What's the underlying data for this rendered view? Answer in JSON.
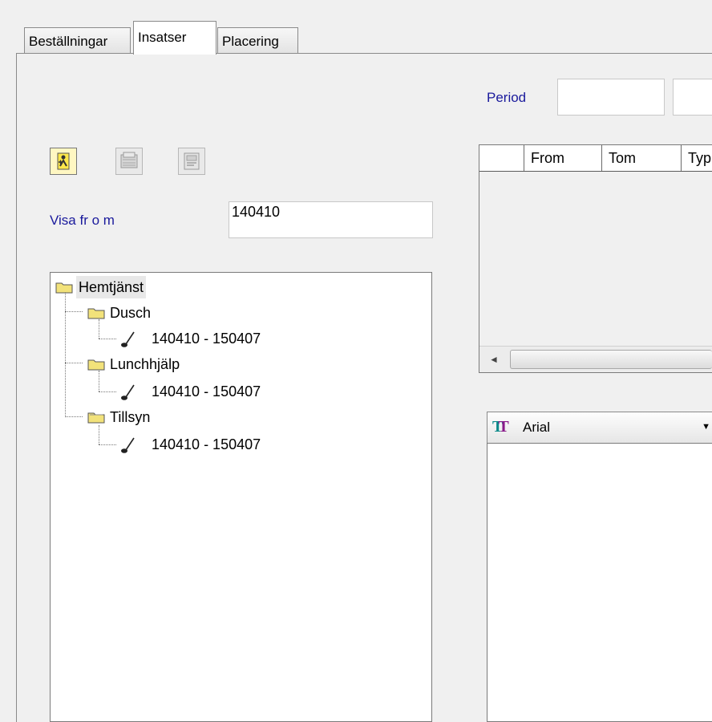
{
  "tabs": [
    {
      "label": "Beställningar",
      "active": false
    },
    {
      "label": "Insatser",
      "active": true
    },
    {
      "label": "Placering",
      "active": false
    }
  ],
  "toolbar": {
    "buttons": [
      {
        "icon": "add-person-icon",
        "enabled": true
      },
      {
        "icon": "printer-icon",
        "enabled": false
      },
      {
        "icon": "edit-form-icon",
        "enabled": false
      }
    ]
  },
  "filter": {
    "label": "Visa fr o m",
    "value": "140410"
  },
  "period": {
    "label": "Period",
    "from_value": "",
    "to_value": ""
  },
  "tree": {
    "root": "Hemtjänst",
    "children": [
      {
        "label": "Dusch",
        "item": "140410 - 150407"
      },
      {
        "label": "Lunchhjälp",
        "item": "140410 - 150407"
      },
      {
        "label": "Tillsyn",
        "item": "140410 - 150407"
      }
    ]
  },
  "grid": {
    "columns": [
      "From",
      "Tom",
      "Typ"
    ],
    "rows": []
  },
  "editor": {
    "font_name": "Arial",
    "font_icon": "truetype-font-icon",
    "text": ""
  },
  "colors": {
    "label_blue": "#1a1a9c",
    "folder_yellow": "#f2e27a"
  }
}
